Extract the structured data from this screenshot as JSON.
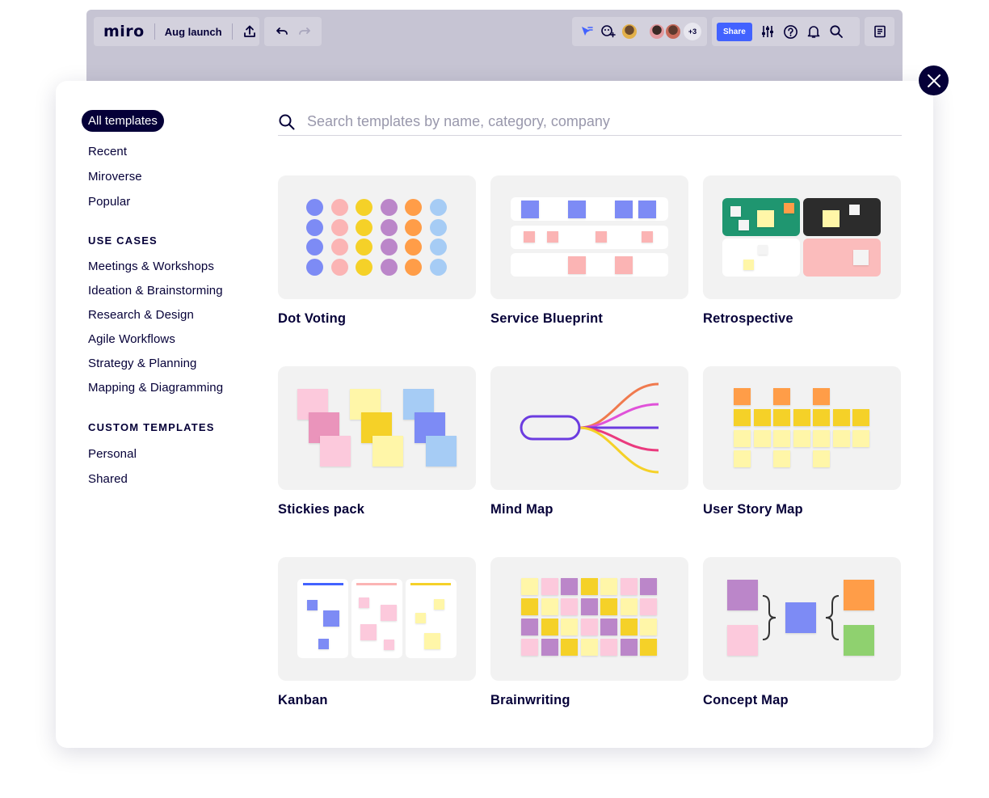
{
  "board": {
    "logo": "miro",
    "board_name": "Aug launch",
    "collaborators_extra": "+3",
    "share_label": "Share"
  },
  "search": {
    "placeholder": "Search templates by name, category, company"
  },
  "sidebar": {
    "active": "All templates",
    "top_items": [
      "Recent",
      "Miroverse",
      "Popular"
    ],
    "use_cases_heading": "USE CASES",
    "use_cases": [
      "Meetings & Workshops",
      "Ideation & Brainstorming",
      "Research & Design",
      "Agile Workflows",
      "Strategy & Planning",
      "Mapping & Diagramming"
    ],
    "custom_heading": "CUSTOM TEMPLATES",
    "custom": [
      "Personal",
      "Shared"
    ]
  },
  "templates": [
    {
      "title": "Dot Voting"
    },
    {
      "title": "Service Blueprint"
    },
    {
      "title": "Retrospective"
    },
    {
      "title": "Stickies pack"
    },
    {
      "title": "Mind Map"
    },
    {
      "title": "User Story Map"
    },
    {
      "title": "Kanban"
    },
    {
      "title": "Brainwriting"
    },
    {
      "title": "Concept Map"
    }
  ],
  "colors": {
    "navy": "#050038",
    "accent_blue": "#4262ff",
    "thumb_bg": "#f2f2f2"
  }
}
